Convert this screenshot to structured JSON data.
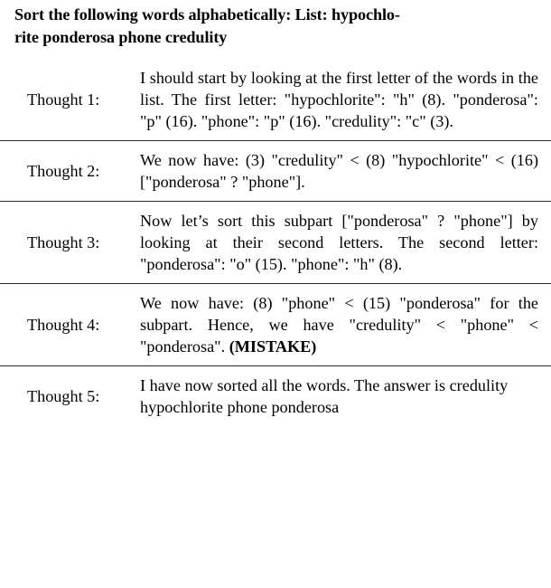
{
  "document": {
    "type": "figure-table",
    "caption": "Sort the following words alphabetically: List: hypochlo-rite ponderosa phone credulity",
    "caption_line_1": "Sort the following words alphabetically: List: hypochlo-",
    "caption_line_2": "rite ponderosa phone credulity",
    "task": "Sort the following words alphabetically",
    "input_list": "hypochlorite ponderosa phone credulity"
  },
  "table": {
    "rows": [
      {
        "label": "Thought 1:",
        "text": "I should start by looking at the first letter of the words in the list.  The first letter: \"hypochlorite\": \"h\" (8). \"ponderosa\": \"p\" (16). \"phone\": \"p\" (16). \"credulity\": \"c\" (3).",
        "mistake_flag": "",
        "has_mistake": false
      },
      {
        "label": "Thought 2:",
        "text": "We now have:  (3) \"credulity\" < (8) \"hypochlorite\" < (16) [\"ponderosa\" ? \"phone\"].",
        "mistake_flag": "",
        "has_mistake": false
      },
      {
        "label": "Thought 3:",
        "text": "Now let’s sort this subpart [\"ponderosa\" ? \"phone\"] by looking at their second letters. The second letter:  \"ponderosa\": \"o\" (15). \"phone\": \"h\" (8).",
        "mistake_flag": "",
        "has_mistake": false
      },
      {
        "label": "Thought 4:",
        "text": "We now have:  (8) \"phone\" < (15) \"ponderosa\" for the subpart.   Hence, we have \"credulity\" < \"phone\" < \"ponderosa\". ",
        "mistake_flag": "(MISTAKE)",
        "has_mistake": true
      },
      {
        "label": "Thought 5:",
        "text": "I have now sorted all the words. The answer is credulity hypochlorite phone ponderosa",
        "mistake_flag": "",
        "has_mistake": false
      }
    ]
  },
  "style": {
    "text_color": "#000000",
    "background_color": "#ffffff",
    "rule_color": "#2b2b2b"
  }
}
